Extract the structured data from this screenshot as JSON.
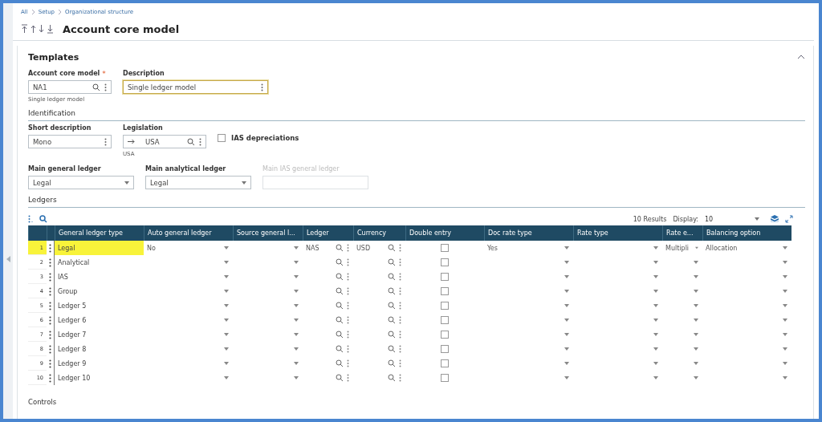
{
  "breadcrumb": [
    "All",
    "Setup",
    "Organizational structure"
  ],
  "title": "Account core model",
  "section": {
    "title": "Templates",
    "expanded": true
  },
  "top_fields": [
    {
      "label": "Account core model",
      "required_mark": "*",
      "kind": "lookup",
      "value": "NA1",
      "focused": false,
      "helper": "Single ledger model"
    },
    {
      "label": "Description",
      "kind": "text",
      "value": "Single ledger model",
      "focused": true
    }
  ],
  "identification": {
    "title": "Identification",
    "fields": [
      {
        "label": "Short description",
        "kind": "text",
        "value": "Mono"
      },
      {
        "label": "Legislation",
        "kind": "link-lookup",
        "value": "USA",
        "helper": "USA"
      }
    ],
    "checkbox": {
      "label": "IAS depreciations",
      "checked": false
    }
  },
  "ledger_fields": [
    {
      "label": "Main general ledger",
      "value": "Legal",
      "disabled": false
    },
    {
      "label": "Main analytical ledger",
      "value": "Legal",
      "disabled": false
    },
    {
      "label": "Main IAS general ledger",
      "disabled": true
    }
  ],
  "ledgers": {
    "title": "Ledgers",
    "results": "10 Results",
    "display_label": "Display:",
    "display_value": "10",
    "columns": [
      {
        "label": "General ledger type",
        "kind": "text"
      },
      {
        "label": "Auto general ledger",
        "kind": "select"
      },
      {
        "label": "Source general l...",
        "kind": "select"
      },
      {
        "label": "Ledger",
        "kind": "lookup"
      },
      {
        "label": "Currency",
        "kind": "lookup"
      },
      {
        "label": "Double entry",
        "kind": "check"
      },
      {
        "label": "Doc rate type",
        "kind": "select"
      },
      {
        "label": "Rate type",
        "kind": "select"
      },
      {
        "label": "Rate e...",
        "kind": "select"
      },
      {
        "label": "Balancing option",
        "kind": "select"
      }
    ],
    "rows": [
      {
        "number": "1",
        "selected": true,
        "cells": [
          "Legal",
          "No",
          null,
          "NAS",
          "USD",
          {
            "checked": false
          },
          "Yes",
          null,
          "Multipli",
          "Allocation"
        ]
      },
      {
        "number": "2",
        "selected": false,
        "cells": [
          "Analytical",
          null,
          null,
          null,
          null,
          {
            "checked": false
          },
          null,
          null,
          null,
          null
        ]
      },
      {
        "number": "3",
        "selected": false,
        "cells": [
          "IAS",
          null,
          null,
          null,
          null,
          {
            "checked": false
          },
          null,
          null,
          null,
          null
        ]
      },
      {
        "number": "4",
        "selected": false,
        "cells": [
          "Group",
          null,
          null,
          null,
          null,
          {
            "checked": false
          },
          null,
          null,
          null,
          null
        ]
      },
      {
        "number": "5",
        "selected": false,
        "cells": [
          "Ledger 5",
          null,
          null,
          null,
          null,
          {
            "checked": false
          },
          null,
          null,
          null,
          null
        ]
      },
      {
        "number": "6",
        "selected": false,
        "cells": [
          "Ledger 6",
          null,
          null,
          null,
          null,
          {
            "checked": false
          },
          null,
          null,
          null,
          null
        ]
      },
      {
        "number": "7",
        "selected": false,
        "cells": [
          "Ledger 7",
          null,
          null,
          null,
          null,
          {
            "checked": false
          },
          null,
          null,
          null,
          null
        ]
      },
      {
        "number": "8",
        "selected": false,
        "cells": [
          "Ledger 8",
          null,
          null,
          null,
          null,
          {
            "checked": false
          },
          null,
          null,
          null,
          null
        ]
      },
      {
        "number": "9",
        "selected": false,
        "cells": [
          "Ledger 9",
          null,
          null,
          null,
          null,
          {
            "checked": false
          },
          null,
          null,
          null,
          null
        ]
      },
      {
        "number": "10",
        "selected": false,
        "cells": [
          "Ledger 10",
          null,
          null,
          null,
          null,
          {
            "checked": false
          },
          null,
          null,
          null,
          null
        ]
      }
    ]
  },
  "controls_title": "Controls"
}
